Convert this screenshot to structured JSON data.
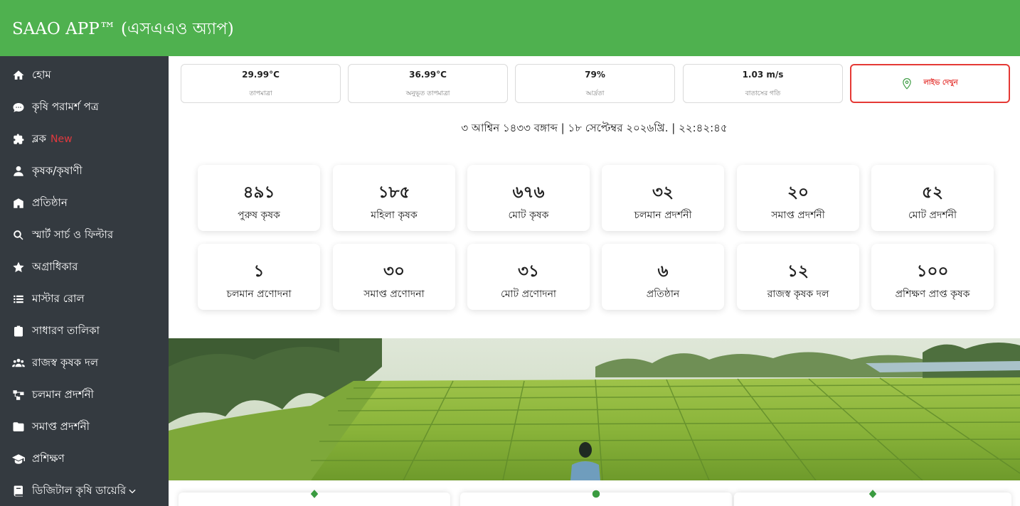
{
  "header": {
    "title": "SAAO APP™ (এসএএও অ্যাপ)",
    "background": "#4fb14f"
  },
  "sidebar": {
    "background": "#343a40",
    "items": [
      {
        "label": "হোম",
        "icon": "home-icon"
      },
      {
        "label": "কৃষি পরামর্শ পত্র",
        "icon": "comment-icon"
      },
      {
        "label": "ব্লক",
        "badge": "New",
        "icon": "puzzle-icon"
      },
      {
        "label": "কৃষক/কৃষাণী",
        "icon": "user-icon"
      },
      {
        "label": "প্রতিষ্ঠান",
        "icon": "building-icon"
      },
      {
        "label": "স্মার্ট সার্চ ও ফিল্টার",
        "icon": "search-icon"
      },
      {
        "label": "অগ্রাধিকার",
        "icon": "star-icon"
      },
      {
        "label": "মাস্টার রোল",
        "icon": "list-icon"
      },
      {
        "label": "সাধারণ তালিকা",
        "icon": "clipboard-icon"
      },
      {
        "label": "রাজস্ব কৃষক দল",
        "icon": "users-icon"
      },
      {
        "label": "চলমান প্রদর্শনী",
        "icon": "sitemap-icon"
      },
      {
        "label": "সমাপ্ত প্রদর্শনী",
        "icon": "folder-icon"
      },
      {
        "label": "প্রশিক্ষণ",
        "icon": "graduation-cap-icon"
      },
      {
        "label": "ডিজিটাল কৃষি ডায়েরি",
        "icon": "book-icon",
        "has_dropdown": true
      }
    ]
  },
  "weather": [
    {
      "value": "29.99°C",
      "label": "তাপমাত্রা"
    },
    {
      "value": "36.99°C",
      "label": "অনুভূত তাপমাত্রা"
    },
    {
      "value": "79%",
      "label": "আর্দ্রতা"
    },
    {
      "value": "1.03 m/s",
      "label": "বাতাসের গতি"
    }
  ],
  "live": {
    "label": "লাইভ দেখুন",
    "icon": "location-pin-icon",
    "color": "#e53935"
  },
  "datetime": "৩ আশ্বিন ১৪৩৩ বঙ্গাব্দ | ১৮ সেপ্টেম্বর ২০২৬খ্রি. | ২২:৪২:৪৫",
  "stats": [
    {
      "value": "৪৯১",
      "label": "পুরুষ কৃষক"
    },
    {
      "value": "১৮৫",
      "label": "মহিলা কৃষক"
    },
    {
      "value": "৬৭৬",
      "label": "মোট কৃষক"
    },
    {
      "value": "৩২",
      "label": "চলমান প্রদর্শনী"
    },
    {
      "value": "২০",
      "label": "সমাপ্ত প্রদর্শনী"
    },
    {
      "value": "৫২",
      "label": "মোট প্রদর্শনী"
    },
    {
      "value": "১",
      "label": "চলমান প্রণোদনা"
    },
    {
      "value": "৩০",
      "label": "সমাপ্ত প্রণোদনা"
    },
    {
      "value": "৩১",
      "label": "মোট প্রণোদনা"
    },
    {
      "value": "৬",
      "label": "প্রতিষ্ঠান"
    },
    {
      "value": "১২",
      "label": "রাজস্ব কৃষক দল"
    },
    {
      "value": "১০০",
      "label": "প্রশিক্ষণ প্রাপ্ত কৃষক"
    }
  ],
  "banner": {
    "image": "rice-field-terraces-with-farmer"
  },
  "bottom_cards": [
    {
      "icon": "leaf-icon"
    },
    {
      "icon": "dot-icon"
    },
    {
      "icon": "leaf-icon"
    }
  ],
  "colors": {
    "accent": "#4fb14f",
    "sidebar": "#343a40",
    "danger": "#e53935"
  }
}
